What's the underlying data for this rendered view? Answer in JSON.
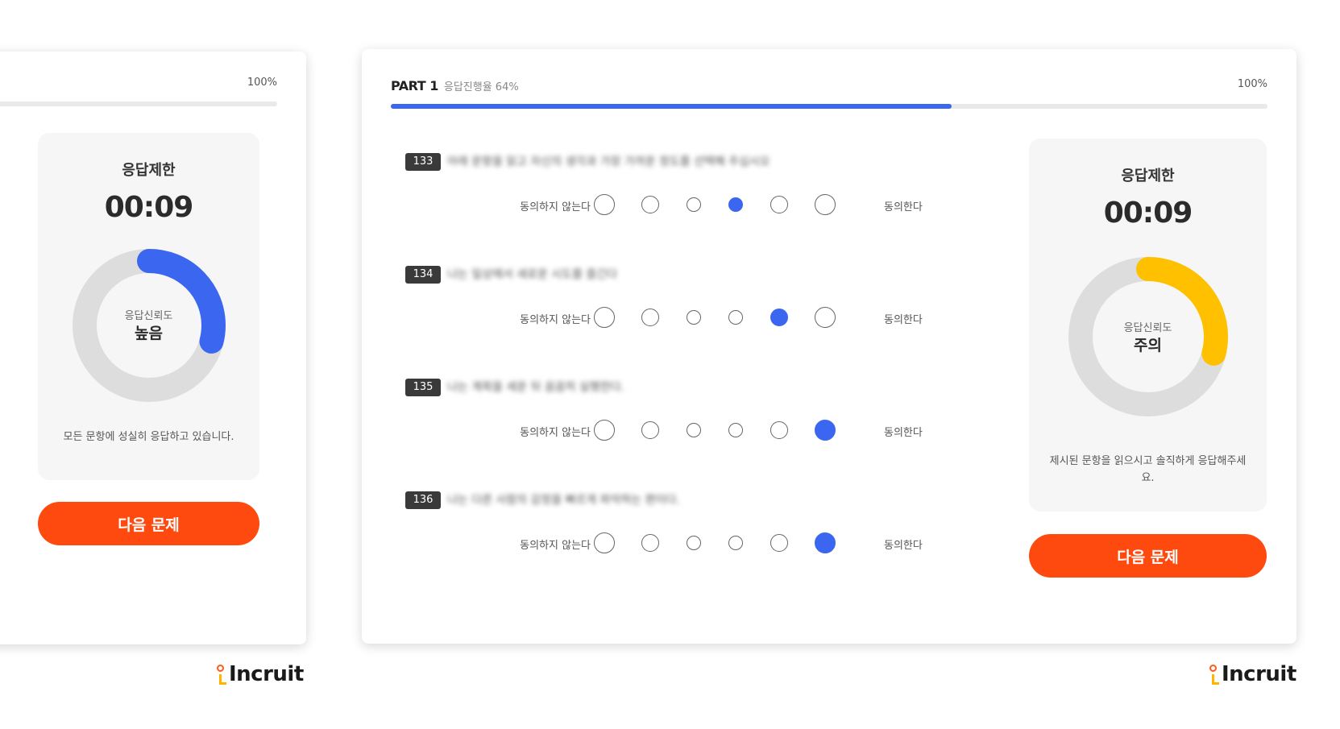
{
  "left_panel": {
    "progress_max_label": "100%",
    "timer_label": "응답제한",
    "time": "00:09",
    "reliability_caption": "응답신뢰도",
    "reliability_value": "높음",
    "reliability_level": 0.29,
    "reliability_color": "#3b67f0",
    "message": "모든 문항에 성실히 응답하고 있습니다.",
    "next_button": "다음 문제",
    "logo": "Incruit"
  },
  "main_panel": {
    "part_label": "PART 1",
    "progress_text": "응답진행율 64%",
    "progress_value": 0.64,
    "progress_max_label": "100%",
    "scale_low_label": "동의하지 않는다",
    "scale_high_label": "동의한다",
    "questions": [
      {
        "number": "133",
        "text": "아래 문항을 읽고 자신의 생각과 가장 가까운 정도를 선택해 주십시오",
        "selected": 4
      },
      {
        "number": "134",
        "text": "나는 일상에서 새로운 시도를 즐긴다",
        "selected": 5
      },
      {
        "number": "135",
        "text": "나는 계획을 세운 뒤 꼼꼼히 실행한다.",
        "selected": 6
      },
      {
        "number": "136",
        "text": "나는 다른 사람의 감정을 빠르게 파악하는 편이다.",
        "selected": 6
      }
    ],
    "timer_label": "응답제한",
    "time": "00:09",
    "reliability_caption": "응답신뢰도",
    "reliability_value": "주의",
    "reliability_level": 0.29,
    "reliability_color": "#ffc000",
    "message": "제시된 문항을 읽으시고 솔직하게 응답해주세요.",
    "next_button": "다음 문제",
    "logo": "Incruit"
  },
  "colors": {
    "accent": "#3b67f0",
    "button": "#ff4a0f",
    "track": "#dddddd"
  }
}
